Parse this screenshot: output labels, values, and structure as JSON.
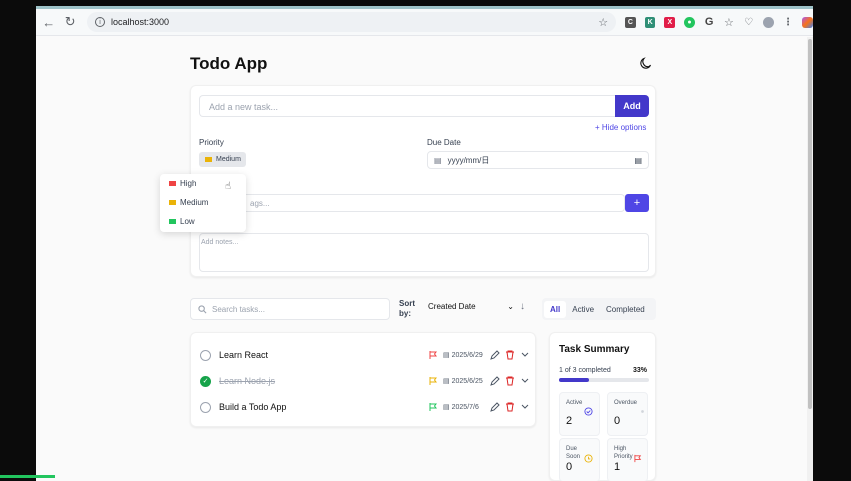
{
  "browser": {
    "url": "localhost:3000"
  },
  "app": {
    "title": "Todo App"
  },
  "add_task": {
    "placeholder": "Add a new task...",
    "add_label": "Add",
    "hide_options_label": "Hide options",
    "priority_label": "Priority",
    "priority_value": "Medium",
    "due_date_label": "Due Date",
    "due_date_value": "yyyy/mm/日",
    "tags_placeholder": "ags...",
    "notes_placeholder": "Add notes..."
  },
  "priority_dropdown": {
    "options": [
      {
        "label": "High",
        "color": "#ef4444"
      },
      {
        "label": "Medium",
        "color": "#eab308"
      },
      {
        "label": "Low",
        "color": "#22c55e"
      }
    ]
  },
  "controls": {
    "search_placeholder": "Search tasks...",
    "sort_label": "Sort by:",
    "sort_value": "Created Date",
    "filters": [
      "All",
      "Active",
      "Completed"
    ],
    "active_filter": "All"
  },
  "tasks": [
    {
      "title": "Learn React",
      "done": false,
      "priority_color": "#ef4444",
      "date": "2025/6/29"
    },
    {
      "title": "Learn Node.js",
      "done": true,
      "priority_color": "#eab308",
      "date": "2025/6/25"
    },
    {
      "title": "Build a Todo App",
      "done": false,
      "priority_color": "#22c55e",
      "date": "2025/7/6"
    }
  ],
  "summary": {
    "title": "Task Summary",
    "progress_text": "1 of 3 completed",
    "percent_label": "33%",
    "percent": 0.33,
    "stats": [
      {
        "label": "Active",
        "value": "2",
        "icon": "check-circle-icon"
      },
      {
        "label": "Overdue",
        "value": "0",
        "icon": "alert-icon"
      },
      {
        "label": "Due Soon",
        "value": "0",
        "icon": "clock-icon"
      },
      {
        "label": "High Priority",
        "value": "1",
        "icon": "flag-icon"
      }
    ]
  },
  "colors": {
    "accent": "#4338ca",
    "done": "#16a34a"
  }
}
